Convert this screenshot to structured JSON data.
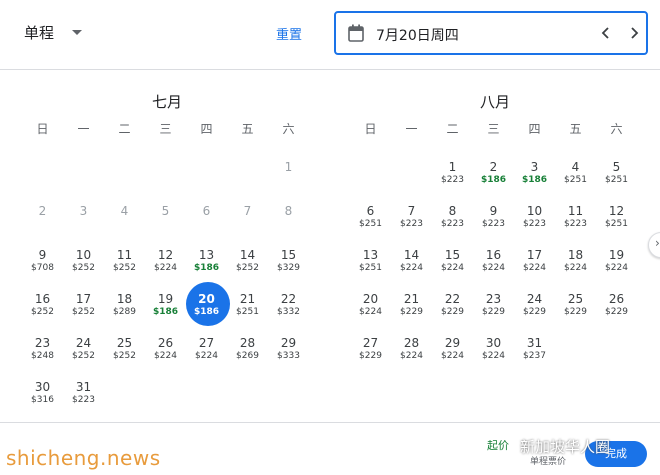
{
  "header": {
    "trip_type": "单程",
    "reset_label": "重置",
    "selected_date": "7月20日周四"
  },
  "weekday_labels": [
    "日",
    "一",
    "二",
    "三",
    "四",
    "五",
    "六"
  ],
  "months": [
    {
      "title": "七月",
      "leading_blanks": 6,
      "days": [
        {
          "d": "1",
          "p": "",
          "past": true
        },
        {
          "d": "2",
          "p": "",
          "past": true
        },
        {
          "d": "3",
          "p": "",
          "past": true
        },
        {
          "d": "4",
          "p": "",
          "past": true
        },
        {
          "d": "5",
          "p": "",
          "past": true
        },
        {
          "d": "6",
          "p": "",
          "past": true
        },
        {
          "d": "7",
          "p": "",
          "past": true
        },
        {
          "d": "8",
          "p": "",
          "past": true
        },
        {
          "d": "9",
          "p": "$708"
        },
        {
          "d": "10",
          "p": "$252"
        },
        {
          "d": "11",
          "p": "$252"
        },
        {
          "d": "12",
          "p": "$224"
        },
        {
          "d": "13",
          "p": "$186",
          "low": true
        },
        {
          "d": "14",
          "p": "$252"
        },
        {
          "d": "15",
          "p": "$329"
        },
        {
          "d": "16",
          "p": "$252"
        },
        {
          "d": "17",
          "p": "$252"
        },
        {
          "d": "18",
          "p": "$289"
        },
        {
          "d": "19",
          "p": "$186",
          "low": true
        },
        {
          "d": "20",
          "p": "$186",
          "selected": true
        },
        {
          "d": "21",
          "p": "$251"
        },
        {
          "d": "22",
          "p": "$332"
        },
        {
          "d": "23",
          "p": "$248"
        },
        {
          "d": "24",
          "p": "$252"
        },
        {
          "d": "25",
          "p": "$252"
        },
        {
          "d": "26",
          "p": "$224"
        },
        {
          "d": "27",
          "p": "$224"
        },
        {
          "d": "28",
          "p": "$269"
        },
        {
          "d": "29",
          "p": "$333"
        },
        {
          "d": "30",
          "p": "$316"
        },
        {
          "d": "31",
          "p": "$223"
        }
      ]
    },
    {
      "title": "八月",
      "leading_blanks": 2,
      "days": [
        {
          "d": "1",
          "p": "$223"
        },
        {
          "d": "2",
          "p": "$186",
          "low": true
        },
        {
          "d": "3",
          "p": "$186",
          "low": true
        },
        {
          "d": "4",
          "p": "$251"
        },
        {
          "d": "5",
          "p": "$251"
        },
        {
          "d": "6",
          "p": "$251"
        },
        {
          "d": "7",
          "p": "$223"
        },
        {
          "d": "8",
          "p": "$223"
        },
        {
          "d": "9",
          "p": "$223"
        },
        {
          "d": "10",
          "p": "$223"
        },
        {
          "d": "11",
          "p": "$223"
        },
        {
          "d": "12",
          "p": "$251"
        },
        {
          "d": "13",
          "p": "$251"
        },
        {
          "d": "14",
          "p": "$224"
        },
        {
          "d": "15",
          "p": "$224"
        },
        {
          "d": "16",
          "p": "$224"
        },
        {
          "d": "17",
          "p": "$224"
        },
        {
          "d": "18",
          "p": "$224"
        },
        {
          "d": "19",
          "p": "$224"
        },
        {
          "d": "20",
          "p": "$224"
        },
        {
          "d": "21",
          "p": "$229"
        },
        {
          "d": "22",
          "p": "$229"
        },
        {
          "d": "23",
          "p": "$229"
        },
        {
          "d": "24",
          "p": "$229"
        },
        {
          "d": "25",
          "p": "$229"
        },
        {
          "d": "26",
          "p": "$229"
        },
        {
          "d": "27",
          "p": "$229"
        },
        {
          "d": "28",
          "p": "$224"
        },
        {
          "d": "29",
          "p": "$224"
        },
        {
          "d": "30",
          "p": "$224"
        },
        {
          "d": "31",
          "p": "$237"
        }
      ]
    }
  ],
  "footer": {
    "from_label": "起价",
    "fare_type": "单程票价",
    "done_label": "完成"
  },
  "watermark": "shicheng.news",
  "watermark2": "新加坡华人圈",
  "colors": {
    "accent": "#1a73e8",
    "low_price": "#188038",
    "text": "#3c4043"
  },
  "icons": [
    "calendar-icon",
    "chevron-down-icon",
    "chevron-left-icon",
    "chevron-right-icon"
  ]
}
